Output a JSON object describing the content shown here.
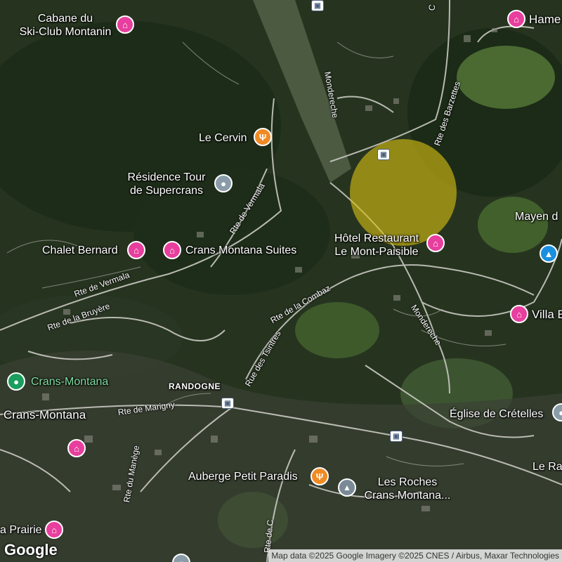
{
  "map": {
    "places": {
      "cabane": "Cabane du\nSki-Club Montanin",
      "hame": "Hame",
      "cervin": "Le Cervin",
      "residence": "Résidence Tour\nde Supercrans",
      "chalet_bernard": "Chalet Bernard",
      "crans_suites": "Crans Montana Suites",
      "hotel_restaurant": "Hôtel Restaurant\nLe Mont-Paisible",
      "mayen": "Mayen d",
      "villa": "Villa E",
      "crans_montana_green": "Crans-Montana",
      "crans_montana": "Crans-Montana",
      "randogne": "RANDOGNE",
      "eglise": "Église de Crételles",
      "le_ra": "Le Ra",
      "auberge": "Auberge Petit Paradis",
      "les_roches": "Les Roches\nCrans Montana...",
      "prairie": "a Prairie"
    },
    "roads": {
      "mondereche_top": "Mondereche",
      "barzettes": "Rte des Barzettes",
      "vermala_1": "Rte de Vermala",
      "vermala_2": "Rte de Vermala",
      "bruyere": "Rte de la Bruyère",
      "combaz": "Rte de la Combaz",
      "tsintres": "Rue des Tsintres",
      "mondereche_mid": "Mondereche",
      "marigny": "Rte de Marigny",
      "manege": "Rte du Manège",
      "rte_de_c": "Rte de C",
      "top_c": "C"
    },
    "icons": {
      "lodging": "bed-icon",
      "restaurant": "fork-knife-icon",
      "landmark": "location-pin-icon",
      "transit": "bus-stop-icon",
      "education": "graduation-cap-icon",
      "shopping": "shopping-bag-icon",
      "city": "city-marker-icon"
    },
    "colors": {
      "lodging_pin": "#e83e9e",
      "restaurant_pin": "#f08a24",
      "landmark_pin": "#8a9ca8",
      "city_pin": "#1a9e5e",
      "shopping_pin": "#1a8fe0",
      "highlight": "#d7be14"
    },
    "brand": "Google",
    "attribution": "Map data ©2025 Google Imagery ©2025 CNES / Airbus, Maxar Technologies"
  }
}
